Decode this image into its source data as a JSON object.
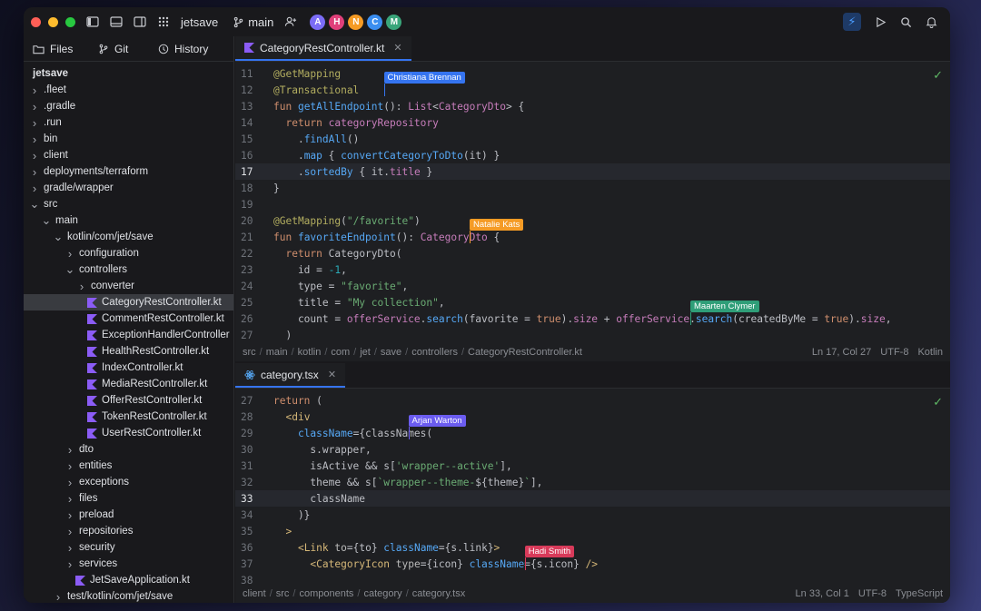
{
  "titlebar": {
    "project": "jetsave",
    "branch": "main",
    "avatars": [
      {
        "letter": "A",
        "color": "#7b6cf6"
      },
      {
        "letter": "H",
        "color": "#e0407a"
      },
      {
        "letter": "N",
        "color": "#f59b25"
      },
      {
        "letter": "C",
        "color": "#3b8ef0"
      },
      {
        "letter": "M",
        "color": "#3aa57a"
      }
    ]
  },
  "sidebar": {
    "tabs": [
      {
        "label": "Files",
        "icon": "folder-icon"
      },
      {
        "label": "Git",
        "icon": "branch-icon"
      },
      {
        "label": "History",
        "icon": "clock-icon"
      }
    ],
    "tree": [
      {
        "label": "jetsave",
        "depth": 0,
        "kind": "root"
      },
      {
        "label": ".fleet",
        "depth": 0,
        "kind": "folder-closed"
      },
      {
        "label": ".gradle",
        "depth": 0,
        "kind": "folder-closed"
      },
      {
        "label": ".run",
        "depth": 0,
        "kind": "folder-closed"
      },
      {
        "label": "bin",
        "depth": 0,
        "kind": "folder-closed"
      },
      {
        "label": "client",
        "depth": 0,
        "kind": "folder-closed"
      },
      {
        "label": "deployments/terraform",
        "depth": 0,
        "kind": "folder-closed"
      },
      {
        "label": "gradle/wrapper",
        "depth": 0,
        "kind": "folder-closed"
      },
      {
        "label": "src",
        "depth": 0,
        "kind": "folder-open"
      },
      {
        "label": "main",
        "depth": 1,
        "kind": "folder-open"
      },
      {
        "label": "kotlin/com/jet/save",
        "depth": 2,
        "kind": "folder-open"
      },
      {
        "label": "configuration",
        "depth": 3,
        "kind": "folder-closed"
      },
      {
        "label": "controllers",
        "depth": 3,
        "kind": "folder-open"
      },
      {
        "label": "converter",
        "depth": 4,
        "kind": "folder-closed"
      },
      {
        "label": "CategoryRestController.kt",
        "depth": 4,
        "kind": "kt",
        "selected": true
      },
      {
        "label": "CommentRestController.kt",
        "depth": 4,
        "kind": "kt"
      },
      {
        "label": "ExceptionHandlerController",
        "depth": 4,
        "kind": "kt"
      },
      {
        "label": "HealthRestController.kt",
        "depth": 4,
        "kind": "kt"
      },
      {
        "label": "IndexController.kt",
        "depth": 4,
        "kind": "kt"
      },
      {
        "label": "MediaRestController.kt",
        "depth": 4,
        "kind": "kt"
      },
      {
        "label": "OfferRestController.kt",
        "depth": 4,
        "kind": "kt"
      },
      {
        "label": "TokenRestController.kt",
        "depth": 4,
        "kind": "kt"
      },
      {
        "label": "UserRestController.kt",
        "depth": 4,
        "kind": "kt"
      },
      {
        "label": "dto",
        "depth": 3,
        "kind": "folder-closed"
      },
      {
        "label": "entities",
        "depth": 3,
        "kind": "folder-closed"
      },
      {
        "label": "exceptions",
        "depth": 3,
        "kind": "folder-closed"
      },
      {
        "label": "files",
        "depth": 3,
        "kind": "folder-closed"
      },
      {
        "label": "preload",
        "depth": 3,
        "kind": "folder-closed"
      },
      {
        "label": "repositories",
        "depth": 3,
        "kind": "folder-closed"
      },
      {
        "label": "security",
        "depth": 3,
        "kind": "folder-closed"
      },
      {
        "label": "services",
        "depth": 3,
        "kind": "folder-closed"
      },
      {
        "label": "JetSaveApplication.kt",
        "depth": 3,
        "kind": "kt"
      },
      {
        "label": "test/kotlin/com/jet/save",
        "depth": 2,
        "kind": "folder-closed"
      }
    ]
  },
  "editor_top": {
    "tab": "CategoryRestController.kt",
    "current_line": 17,
    "lines": [
      {
        "n": "11",
        "html": "<span class=\"an\">@GetMapping</span>"
      },
      {
        "n": "12",
        "html": "<span class=\"an\">@Transactional</span>"
      },
      {
        "n": "13",
        "html": "<span class=\"kw\">fun </span><span class=\"fn\">getAllEndpoint</span>(): <span class=\"ty\">List</span>&lt;<span class=\"ty\">CategoryDto</span>&gt; {"
      },
      {
        "n": "14",
        "html": "  <span class=\"kw\">return </span><span class=\"pr\">categoryRepository</span>"
      },
      {
        "n": "15",
        "html": "    .<span class=\"fn\">findAll</span>()"
      },
      {
        "n": "16",
        "html": "    .<span class=\"fn\">map</span> { <span class=\"fn\">convertCategoryToDto</span>(it) }"
      },
      {
        "n": "17",
        "html": "    .<span class=\"fn\">sortedBy</span> { it.<span class=\"pr\">title</span> }"
      },
      {
        "n": "18",
        "html": "}"
      },
      {
        "n": "19",
        "html": ""
      },
      {
        "n": "20",
        "html": "<span class=\"an\">@GetMapping</span>(<span class=\"st\">\"/favorite\"</span>)"
      },
      {
        "n": "21",
        "html": "<span class=\"kw\">fun </span><span class=\"fn\">favoriteEndpoint</span>(): <span class=\"ty\">CategoryDto</span> {"
      },
      {
        "n": "22",
        "html": "  <span class=\"kw\">return </span>CategoryDto("
      },
      {
        "n": "23",
        "html": "    id = <span class=\"nu\">-1</span>,"
      },
      {
        "n": "24",
        "html": "    type = <span class=\"st\">\"favorite\"</span>,"
      },
      {
        "n": "25",
        "html": "    title = <span class=\"st\">\"My collection\"</span>,"
      },
      {
        "n": "26",
        "html": "    count = <span class=\"pr\">offerService</span>.<span class=\"fn\">search</span>(favorite = <span class=\"kw\">true</span>).<span class=\"pr\">size</span> + <span class=\"pr\">offerService</span>.<span class=\"fn\">search</span>(createdByMe = <span class=\"kw\">true</span>).<span class=\"pr\">size</span>,"
      },
      {
        "n": "27",
        "html": "  )"
      }
    ],
    "cursors": [
      {
        "name": "Christiana Brennan",
        "color": "#3574f0",
        "line": 1,
        "col": 18
      },
      {
        "name": "Natalie Kats",
        "color": "#f59b25",
        "line": 10,
        "col": 32
      },
      {
        "name": "Maarten Clymer",
        "color": "#2f9e78",
        "line": 15,
        "col": 68
      }
    ],
    "breadcrumb": [
      "src",
      "main",
      "kotlin",
      "com",
      "jet",
      "save",
      "controllers",
      "CategoryRestController.kt"
    ],
    "position": "Ln 17, Col 27",
    "encoding": "UTF-8",
    "language": "Kotlin"
  },
  "editor_bottom": {
    "tab": "category.tsx",
    "current_line": 33,
    "lines": [
      {
        "n": "27",
        "html": "<span class=\"kw\">return </span>("
      },
      {
        "n": "28",
        "html": "  <span class=\"tg\">&lt;div</span>"
      },
      {
        "n": "29",
        "html": "    <span class=\"fn\">className</span>={classNames("
      },
      {
        "n": "30",
        "html": "      s.wrapper,"
      },
      {
        "n": "31",
        "html": "      isActive &amp;&amp; s[<span class=\"st\">'wrapper--active'</span>],"
      },
      {
        "n": "32",
        "html": "      theme &amp;&amp; s[<span class=\"st\">`wrapper--theme-</span>${theme}<span class=\"st\">`</span>],"
      },
      {
        "n": "33",
        "html": "      className"
      },
      {
        "n": "34",
        "html": "    )}"
      },
      {
        "n": "35",
        "html": "  <span class=\"tg\">&gt;</span>"
      },
      {
        "n": "36",
        "html": "    <span class=\"tg\">&lt;Link</span> <span class=\"at\">to</span>={to} <span class=\"fn\">className</span>={s.link}<span class=\"tg\">&gt;</span>"
      },
      {
        "n": "37",
        "html": "      <span class=\"tg\">&lt;CategoryIcon</span> <span class=\"at\">type</span>={icon} <span class=\"fn\">className</span>={s.icon} <span class=\"tg\">/&gt;</span>"
      },
      {
        "n": "38",
        "html": ""
      }
    ],
    "cursors": [
      {
        "name": "Arjan Warton",
        "color": "#6b5cf0",
        "line": 2,
        "col": 22
      },
      {
        "name": "Hadi Smith",
        "color": "#d83a5a",
        "line": 10,
        "col": 41
      }
    ],
    "breadcrumb": [
      "client",
      "src",
      "components",
      "category",
      "category.tsx"
    ],
    "position": "Ln 33, Col 1",
    "encoding": "UTF-8",
    "language": "TypeScript"
  },
  "icons": {
    "check": "check-icon",
    "kotlin_file": "kotlin-file-icon",
    "react_file": "react-file-icon",
    "bolt": "lightning-icon",
    "run": "play-icon",
    "search": "search-icon",
    "notifications": "bell-icon"
  },
  "colors": {
    "kotlin_icon": "#8b5cf6",
    "react_icon": "#56a8f5"
  }
}
